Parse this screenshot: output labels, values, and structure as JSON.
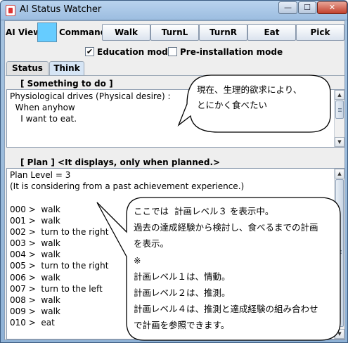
{
  "window": {
    "title": "AI Status Watcher",
    "controls": {
      "minimize": "—",
      "maximize": "☐",
      "close": "✕"
    }
  },
  "toolbar": {
    "ai_view_label": "AI View",
    "ai_view_color": "#66ccff",
    "command_label": "Command",
    "buttons": [
      "Walk",
      "TurnL",
      "TurnR",
      "Eat",
      "Pick"
    ]
  },
  "options": {
    "education_mode": {
      "label": "Education mode",
      "checked": true
    },
    "preinstallation_mode": {
      "label": "Pre-installation mode",
      "checked": false
    }
  },
  "tabs": [
    {
      "label": "Status",
      "selected": false
    },
    {
      "label": "Think",
      "selected": true
    }
  ],
  "something_to_do": {
    "title": "[ Something to do ]",
    "lines": [
      "Physiological drives (Physical desire) :",
      "  When anyhow",
      "    I want to eat."
    ]
  },
  "plan": {
    "title": "[ Plan ] <It displays, only when planned.>",
    "lines": [
      "Plan Level = 3",
      "(It is considering from a past achievement experience.)",
      "",
      "000 >  walk",
      "001 >  walk",
      "002 >  turn to the right",
      "003 >  walk",
      "004 >  walk",
      "005 >  turn to the right",
      "006 >  walk",
      "007 >  turn to the left",
      "008 >  walk",
      "009 >  walk",
      "010 >  eat"
    ]
  },
  "callouts": {
    "top": [
      "現在、生理的欲求により、",
      "とにかく食べたい"
    ],
    "bottom": [
      "ここでは  計画レベル３ を表示中。",
      "過去の達成経験から検討し、食べるまでの計画",
      "を表示。",
      "※",
      "計画レベル１は、情動。",
      "計画レベル２は、推測。",
      "計画レベル４は、推測と達成経験の組み合わせ",
      "で計画を参照できます。"
    ]
  }
}
